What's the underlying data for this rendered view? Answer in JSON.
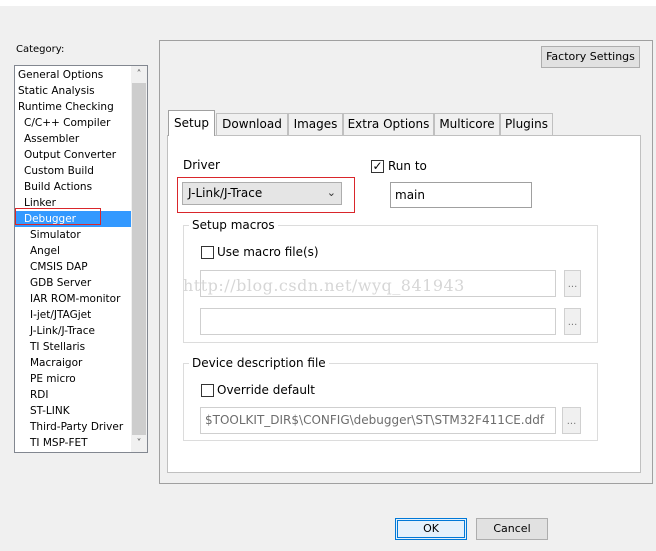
{
  "category": {
    "label": "Category:",
    "items": [
      {
        "label": "General Options",
        "indent": 0
      },
      {
        "label": "Static Analysis",
        "indent": 0
      },
      {
        "label": "Runtime Checking",
        "indent": 0
      },
      {
        "label": "C/C++ Compiler",
        "indent": 1
      },
      {
        "label": "Assembler",
        "indent": 1
      },
      {
        "label": "Output Converter",
        "indent": 1
      },
      {
        "label": "Custom Build",
        "indent": 1
      },
      {
        "label": "Build Actions",
        "indent": 1
      },
      {
        "label": "Linker",
        "indent": 1
      },
      {
        "label": "Debugger",
        "indent": 1,
        "selected": true
      },
      {
        "label": "Simulator",
        "indent": 2
      },
      {
        "label": "Angel",
        "indent": 2
      },
      {
        "label": "CMSIS DAP",
        "indent": 2
      },
      {
        "label": "GDB Server",
        "indent": 2
      },
      {
        "label": "IAR ROM-monitor",
        "indent": 2
      },
      {
        "label": "I-jet/JTAGjet",
        "indent": 2
      },
      {
        "label": "J-Link/J-Trace",
        "indent": 2
      },
      {
        "label": "TI Stellaris",
        "indent": 2
      },
      {
        "label": "Macraigor",
        "indent": 2
      },
      {
        "label": "PE micro",
        "indent": 2
      },
      {
        "label": "RDI",
        "indent": 2
      },
      {
        "label": "ST-LINK",
        "indent": 2
      },
      {
        "label": "Third-Party Driver",
        "indent": 2
      },
      {
        "label": "TI MSP-FET",
        "indent": 2
      }
    ]
  },
  "factory_settings_label": "Factory Settings",
  "tabs": [
    {
      "label": "Setup",
      "active": true
    },
    {
      "label": "Download"
    },
    {
      "label": "Images"
    },
    {
      "label": "Extra Options"
    },
    {
      "label": "Multicore"
    },
    {
      "label": "Plugins"
    }
  ],
  "setup": {
    "driver_label": "Driver",
    "driver_value": "J-Link/J-Trace",
    "run_to_label": "Run to",
    "run_to_checked": true,
    "run_to_value": "main",
    "setup_macros_title": "Setup macros",
    "use_macro_label": "Use macro file(s)",
    "use_macro_checked": false,
    "macro_file_1": "",
    "macro_file_2": "",
    "device_desc_title": "Device description file",
    "override_label": "Override default",
    "override_checked": false,
    "device_desc_path": "$TOOLKIT_DIR$\\CONFIG\\debugger\\ST\\STM32F411CE.ddf",
    "browse_label": "..."
  },
  "watermark": "http://blog.csdn.net/wyq_841943",
  "buttons": {
    "ok": "OK",
    "cancel": "Cancel"
  },
  "colors": {
    "selection": "#3399ff",
    "highlight_red": "#d9262b",
    "ok_border": "#0078d7"
  },
  "icons": {
    "scroll_up": "chevron-up-icon",
    "scroll_down": "chevron-down-icon",
    "dropdown": "chevron-down-icon",
    "check": "checkmark-icon"
  }
}
